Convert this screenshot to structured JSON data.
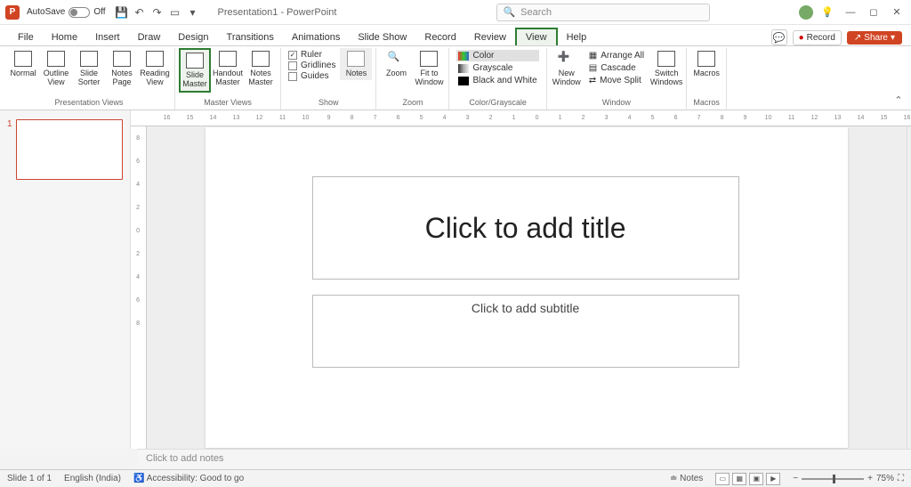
{
  "titlebar": {
    "autosave_label": "AutoSave",
    "autosave_state": "Off",
    "doc_title": "Presentation1 - PowerPoint",
    "search_placeholder": "Search"
  },
  "tabs": {
    "items": [
      "File",
      "Home",
      "Insert",
      "Draw",
      "Design",
      "Transitions",
      "Animations",
      "Slide Show",
      "Record",
      "Review",
      "View",
      "Help"
    ],
    "active": "View",
    "record_label": "Record",
    "share_label": "Share"
  },
  "ribbon": {
    "presentation_views": {
      "label": "Presentation Views",
      "items": [
        "Normal",
        "Outline View",
        "Slide Sorter",
        "Notes Page",
        "Reading View"
      ]
    },
    "master_views": {
      "label": "Master Views",
      "items": [
        "Slide Master",
        "Handout Master",
        "Notes Master"
      ]
    },
    "show": {
      "label": "Show",
      "ruler": "Ruler",
      "gridlines": "Gridlines",
      "guides": "Guides",
      "notes": "Notes"
    },
    "zoom": {
      "label": "Zoom",
      "zoom_btn": "Zoom",
      "fit_btn": "Fit to Window"
    },
    "color": {
      "label": "Color/Grayscale",
      "color": "Color",
      "gray": "Grayscale",
      "bw": "Black and White"
    },
    "window": {
      "label": "Window",
      "new": "New Window",
      "arrange": "Arrange All",
      "cascade": "Cascade",
      "split": "Move Split",
      "switch": "Switch Windows"
    },
    "macros": {
      "label": "Macros",
      "btn": "Macros"
    }
  },
  "thumb": {
    "slide_num": "1"
  },
  "slide": {
    "title_placeholder": "Click to add title",
    "subtitle_placeholder": "Click to add subtitle"
  },
  "notes": {
    "placeholder": "Click to add notes"
  },
  "statusbar": {
    "slide_info": "Slide 1 of 1",
    "language": "English (India)",
    "accessibility": "Accessibility: Good to go",
    "notes_btn": "Notes",
    "zoom_pct": "75%"
  },
  "ruler_h": [
    "16",
    "15",
    "14",
    "13",
    "12",
    "11",
    "10",
    "9",
    "8",
    "7",
    "6",
    "5",
    "4",
    "3",
    "2",
    "1",
    "0",
    "1",
    "2",
    "3",
    "4",
    "5",
    "6",
    "7",
    "8",
    "9",
    "10",
    "11",
    "12",
    "13",
    "14",
    "15",
    "16"
  ],
  "ruler_v": [
    "8",
    "6",
    "4",
    "2",
    "0",
    "2",
    "4",
    "6",
    "8"
  ]
}
